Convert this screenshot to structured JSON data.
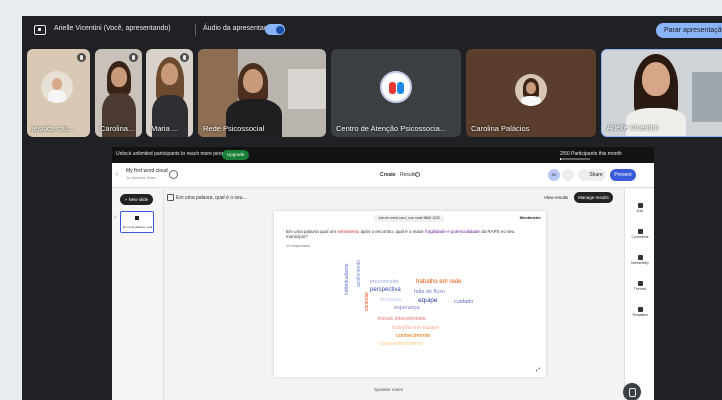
{
  "topbar": {
    "presenter": "Arielle Vicentini (Você, apresentando)",
    "audio_label": "Áudio da apresentação",
    "audio_on": true,
    "stop_label": "Parar apresentação"
  },
  "participants": [
    {
      "name": "jessica cas..."
    },
    {
      "name": "Carolina..."
    },
    {
      "name": "Maria ..."
    },
    {
      "name": "Rede Psicossocial"
    },
    {
      "name": "Centro de Atenção Psicossocia..."
    },
    {
      "name": "Carolina Palácios"
    },
    {
      "name": "Arielle Vicentini"
    }
  ],
  "shared_screen": {
    "banner_text": "Unlock unlimited participants to reach more people.",
    "upgrade_label": "Upgrade",
    "limit_text": "2/50 Participants this month",
    "limit_fraction": 0.04,
    "presentation_title": "My first word cloud",
    "presentation_subtitle": "Jo Almeida Sáez",
    "tabs": {
      "create": "Create",
      "results": "Results"
    },
    "avatar_initials": "AV",
    "share_label": "Share",
    "present_label": "Present",
    "new_slide_label": "+ New slide",
    "slide_number": "1",
    "slide_thumb_label": "Em uma palavra, qual...",
    "slide_type_label": "Em uma palavra, qual é o seu...",
    "view_results_label": "View results",
    "manage_results_label": "Manage results",
    "join_code": "Join at menti.com | use code 5865 1232",
    "brand": "Mentimeter",
    "question_pre": "Em uma palavra qual um ",
    "question_red": "sentimento",
    "question_mid": " após o encontro, qual é o maior ",
    "question_purple": "fragilidade e potencialidade",
    "question_post": " da RAPS no seu município?",
    "responses": "19 responses",
    "speaker_notes": "Speaker notes",
    "right_panel": [
      "Edit",
      "Comments",
      "Interactivity",
      "Themes",
      "Templates"
    ]
  },
  "word_cloud": [
    {
      "text": "preconceito",
      "color": "#9fa8da",
      "size": 5.5
    },
    {
      "text": "trabalho em rede",
      "color": "#e65100",
      "size": 6
    },
    {
      "text": "perspectiva",
      "color": "#3949ab",
      "size": 6
    },
    {
      "text": "falta de fluxo",
      "color": "#7986cb",
      "size": 5.5
    },
    {
      "text": "desgaste",
      "color": "#c5cae9",
      "size": 5.5
    },
    {
      "text": "equipe",
      "color": "#283593",
      "size": 6.5
    },
    {
      "text": "cuidado",
      "color": "#5c6bc0",
      "size": 5.5
    },
    {
      "text": "esperança",
      "color": "#9575cd",
      "size": 5.5
    },
    {
      "text": "trocas intersetoriais",
      "color": "#e57373",
      "size": 5.5
    },
    {
      "text": "trabalho em equipe",
      "color": "#ffab91",
      "size": 5.5
    },
    {
      "text": "conhecimento",
      "color": "#ef6c00",
      "size": 5.5
    },
    {
      "text": "compartilhamento",
      "color": "#ffcc80",
      "size": 5.5
    },
    {
      "text": "individualismo",
      "color": "#5c6bc0",
      "size": 5
    },
    {
      "text": "acolhimento",
      "color": "#7986cb",
      "size": 5
    },
    {
      "text": "conectar",
      "color": "#e64a19",
      "size": 5
    }
  ]
}
